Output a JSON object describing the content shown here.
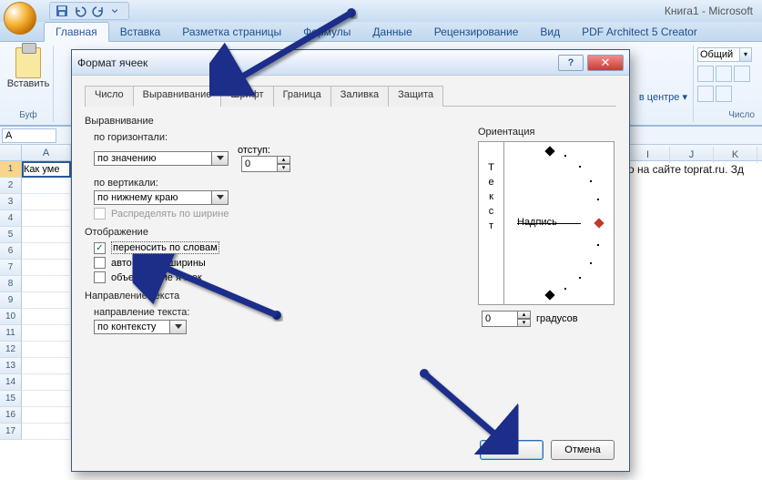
{
  "app": {
    "title": "Книга1 - Microsoft"
  },
  "ribbon": {
    "tabs": [
      "Главная",
      "Вставка",
      "Разметка страницы",
      "Формулы",
      "Данные",
      "Рецензирование",
      "Вид",
      "PDF Architect 5 Creator"
    ],
    "active_tab_index": 0,
    "clipboard_group": {
      "paste_label": "Вставить",
      "group_label": "Буф"
    },
    "alignment_fragment": "в центре ▾",
    "number_group": {
      "label": "Число",
      "format_value": "Общий"
    }
  },
  "namebox": {
    "value": "A"
  },
  "sheet": {
    "visible_a1": "Как уме",
    "right_text": "о на сайте toprat.ru. Зд",
    "right_cols": [
      "I",
      "J",
      "K"
    ]
  },
  "dialog": {
    "title": "Формат ячеек",
    "tabs": [
      "Число",
      "Выравнивание",
      "Шрифт",
      "Граница",
      "Заливка",
      "Защита"
    ],
    "active_tab_index": 1,
    "alignment_section": "Выравнивание",
    "h_label": "по горизонтали:",
    "h_value": "по значению",
    "indent_label": "отступ:",
    "indent_value": "0",
    "v_label": "по вертикали:",
    "v_value": "по нижнему краю",
    "distribute_label": "Распределять по ширине",
    "display_section": "Отображение",
    "wrap_label": "переносить по словам",
    "shrink_label": "автоподбор ширины",
    "merge_label": "объединение ячеек",
    "text_dir_section": "Направление текста",
    "text_dir_label": "направление текста:",
    "text_dir_value": "по контексту",
    "orientation_section": "Ориентация",
    "orient_vertical_text": "Текст",
    "orient_inline_label": "Надпись",
    "degrees_value": "0",
    "degrees_label": "градусов",
    "ok": "ОК",
    "cancel": "Отмена"
  }
}
